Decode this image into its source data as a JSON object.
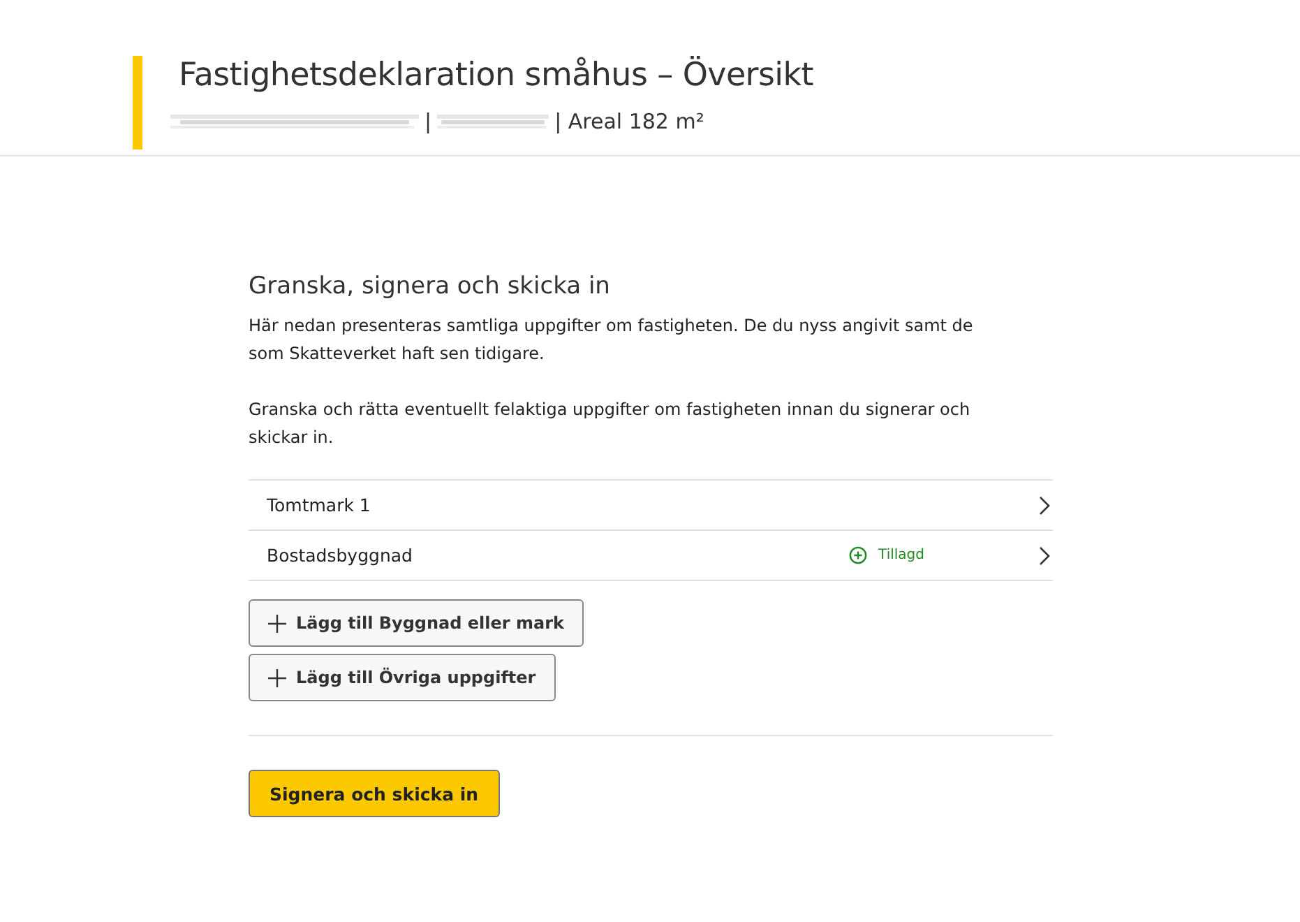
{
  "header": {
    "title": "Fastighetsdeklaration småhus – Översikt",
    "subtitle": [
      {
        "kind": "redacted"
      },
      {
        "kind": "text",
        "text": "|"
      },
      {
        "kind": "redacted"
      },
      {
        "kind": "text",
        "text": "| Areal 182 m²"
      }
    ]
  },
  "section": {
    "heading": "Granska, signera och skicka in",
    "paragraphs": [
      "Här nedan presenteras samtliga uppgifter om fastigheten. De du nyss angivit samt de som Skatteverket haft sen tidigare.",
      "Granska och rätta eventuellt felaktiga uppgifter om fastigheten innan du signerar och skickar in."
    ],
    "items": [
      {
        "label": "Tomtmark 1"
      },
      {
        "label": "Bostadsbyggnad",
        "status": "Tillagd"
      }
    ],
    "add_buttons": [
      "Lägg till Byggnad eller mark",
      "Lägg till Övriga uppgifter"
    ],
    "submit_button": "Signera och skicka in"
  }
}
